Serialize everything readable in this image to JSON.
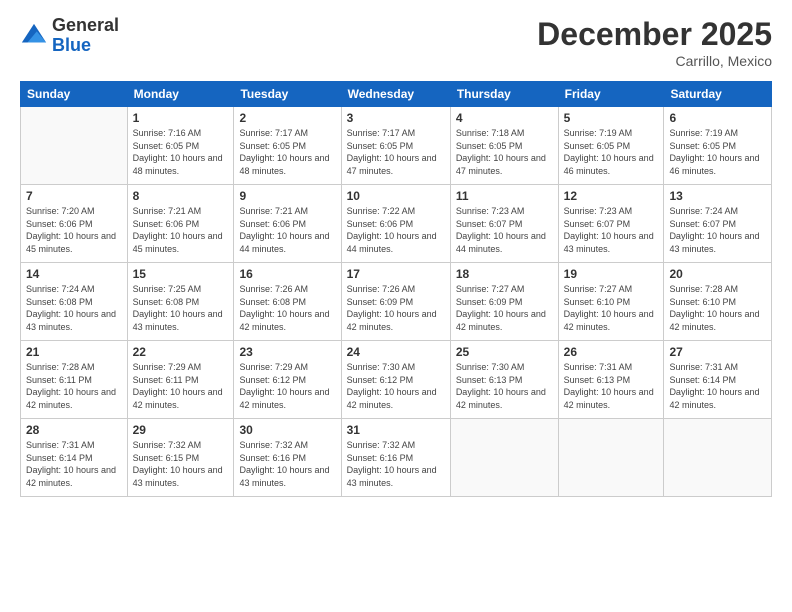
{
  "logo": {
    "general": "General",
    "blue": "Blue"
  },
  "header": {
    "month": "December 2025",
    "location": "Carrillo, Mexico"
  },
  "weekdays": [
    "Sunday",
    "Monday",
    "Tuesday",
    "Wednesday",
    "Thursday",
    "Friday",
    "Saturday"
  ],
  "weeks": [
    [
      {
        "day": "",
        "info": ""
      },
      {
        "day": "1",
        "info": "Sunrise: 7:16 AM\nSunset: 6:05 PM\nDaylight: 10 hours\nand 48 minutes."
      },
      {
        "day": "2",
        "info": "Sunrise: 7:17 AM\nSunset: 6:05 PM\nDaylight: 10 hours\nand 48 minutes."
      },
      {
        "day": "3",
        "info": "Sunrise: 7:17 AM\nSunset: 6:05 PM\nDaylight: 10 hours\nand 47 minutes."
      },
      {
        "day": "4",
        "info": "Sunrise: 7:18 AM\nSunset: 6:05 PM\nDaylight: 10 hours\nand 47 minutes."
      },
      {
        "day": "5",
        "info": "Sunrise: 7:19 AM\nSunset: 6:05 PM\nDaylight: 10 hours\nand 46 minutes."
      },
      {
        "day": "6",
        "info": "Sunrise: 7:19 AM\nSunset: 6:05 PM\nDaylight: 10 hours\nand 46 minutes."
      }
    ],
    [
      {
        "day": "7",
        "info": "Sunrise: 7:20 AM\nSunset: 6:06 PM\nDaylight: 10 hours\nand 45 minutes."
      },
      {
        "day": "8",
        "info": "Sunrise: 7:21 AM\nSunset: 6:06 PM\nDaylight: 10 hours\nand 45 minutes."
      },
      {
        "day": "9",
        "info": "Sunrise: 7:21 AM\nSunset: 6:06 PM\nDaylight: 10 hours\nand 44 minutes."
      },
      {
        "day": "10",
        "info": "Sunrise: 7:22 AM\nSunset: 6:06 PM\nDaylight: 10 hours\nand 44 minutes."
      },
      {
        "day": "11",
        "info": "Sunrise: 7:23 AM\nSunset: 6:07 PM\nDaylight: 10 hours\nand 44 minutes."
      },
      {
        "day": "12",
        "info": "Sunrise: 7:23 AM\nSunset: 6:07 PM\nDaylight: 10 hours\nand 43 minutes."
      },
      {
        "day": "13",
        "info": "Sunrise: 7:24 AM\nSunset: 6:07 PM\nDaylight: 10 hours\nand 43 minutes."
      }
    ],
    [
      {
        "day": "14",
        "info": "Sunrise: 7:24 AM\nSunset: 6:08 PM\nDaylight: 10 hours\nand 43 minutes."
      },
      {
        "day": "15",
        "info": "Sunrise: 7:25 AM\nSunset: 6:08 PM\nDaylight: 10 hours\nand 43 minutes."
      },
      {
        "day": "16",
        "info": "Sunrise: 7:26 AM\nSunset: 6:08 PM\nDaylight: 10 hours\nand 42 minutes."
      },
      {
        "day": "17",
        "info": "Sunrise: 7:26 AM\nSunset: 6:09 PM\nDaylight: 10 hours\nand 42 minutes."
      },
      {
        "day": "18",
        "info": "Sunrise: 7:27 AM\nSunset: 6:09 PM\nDaylight: 10 hours\nand 42 minutes."
      },
      {
        "day": "19",
        "info": "Sunrise: 7:27 AM\nSunset: 6:10 PM\nDaylight: 10 hours\nand 42 minutes."
      },
      {
        "day": "20",
        "info": "Sunrise: 7:28 AM\nSunset: 6:10 PM\nDaylight: 10 hours\nand 42 minutes."
      }
    ],
    [
      {
        "day": "21",
        "info": "Sunrise: 7:28 AM\nSunset: 6:11 PM\nDaylight: 10 hours\nand 42 minutes."
      },
      {
        "day": "22",
        "info": "Sunrise: 7:29 AM\nSunset: 6:11 PM\nDaylight: 10 hours\nand 42 minutes."
      },
      {
        "day": "23",
        "info": "Sunrise: 7:29 AM\nSunset: 6:12 PM\nDaylight: 10 hours\nand 42 minutes."
      },
      {
        "day": "24",
        "info": "Sunrise: 7:30 AM\nSunset: 6:12 PM\nDaylight: 10 hours\nand 42 minutes."
      },
      {
        "day": "25",
        "info": "Sunrise: 7:30 AM\nSunset: 6:13 PM\nDaylight: 10 hours\nand 42 minutes."
      },
      {
        "day": "26",
        "info": "Sunrise: 7:31 AM\nSunset: 6:13 PM\nDaylight: 10 hours\nand 42 minutes."
      },
      {
        "day": "27",
        "info": "Sunrise: 7:31 AM\nSunset: 6:14 PM\nDaylight: 10 hours\nand 42 minutes."
      }
    ],
    [
      {
        "day": "28",
        "info": "Sunrise: 7:31 AM\nSunset: 6:14 PM\nDaylight: 10 hours\nand 42 minutes."
      },
      {
        "day": "29",
        "info": "Sunrise: 7:32 AM\nSunset: 6:15 PM\nDaylight: 10 hours\nand 43 minutes."
      },
      {
        "day": "30",
        "info": "Sunrise: 7:32 AM\nSunset: 6:16 PM\nDaylight: 10 hours\nand 43 minutes."
      },
      {
        "day": "31",
        "info": "Sunrise: 7:32 AM\nSunset: 6:16 PM\nDaylight: 10 hours\nand 43 minutes."
      },
      {
        "day": "",
        "info": ""
      },
      {
        "day": "",
        "info": ""
      },
      {
        "day": "",
        "info": ""
      }
    ]
  ]
}
